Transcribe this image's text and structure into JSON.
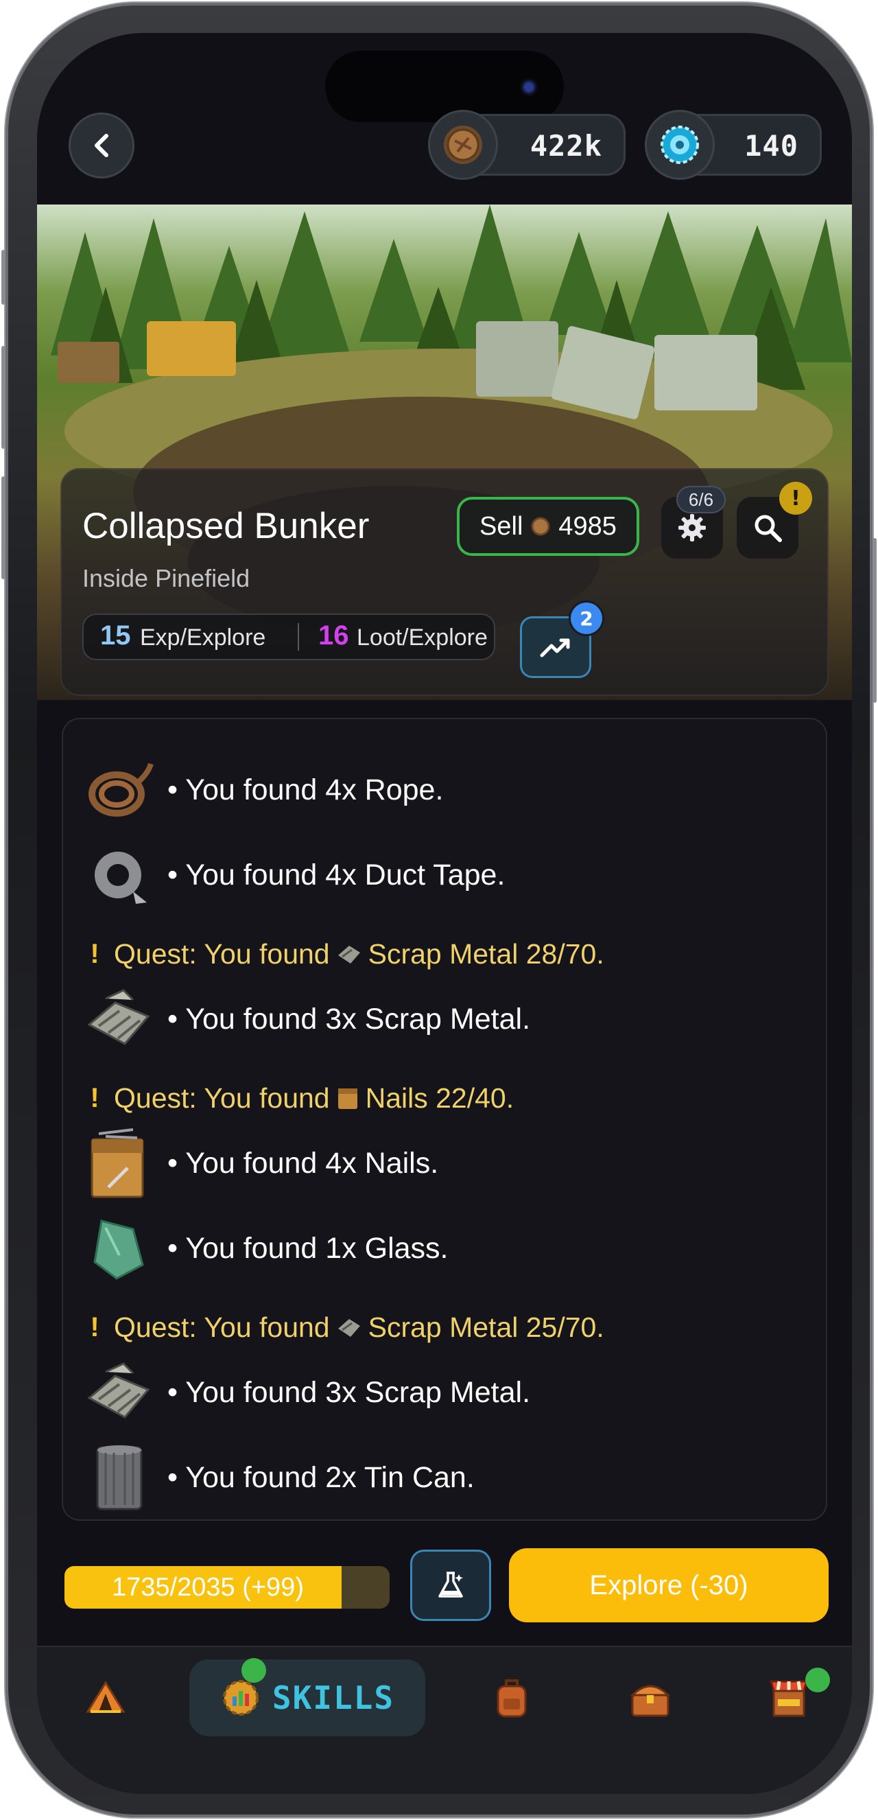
{
  "topbar": {
    "back_label": "back",
    "coins": {
      "icon": "gear-coin-icon",
      "value": "422k"
    },
    "gems": {
      "icon": "blue-gear-icon",
      "value": "140"
    }
  },
  "location": {
    "title": "Collapsed Bunker",
    "subtitle": "Inside Pinefield",
    "sell_label": "Sell",
    "sell_value": "4985",
    "settings_badge": "6/6",
    "search_alert": "!",
    "exp_value": "15",
    "exp_label": "Exp/Explore",
    "loot_value": "16",
    "loot_label": "Loot/Explore",
    "trend_badge": "2",
    "colors": {
      "exp": "#8fc9f4",
      "loot": "#d43ff0",
      "sell_border": "#39b54a"
    }
  },
  "log": [
    {
      "type": "item",
      "icon": "rope-icon",
      "text": "• You found 4x Rope."
    },
    {
      "type": "item",
      "icon": "duct-tape-icon",
      "text": "• You found 4x Duct Tape."
    },
    {
      "type": "quest",
      "icon": "scrap-metal-icon",
      "prefix": "Quest: You found",
      "text": "Scrap Metal 28/70."
    },
    {
      "type": "item",
      "icon": "scrap-metal-icon",
      "text": "• You found 3x Scrap Metal."
    },
    {
      "type": "quest",
      "icon": "nails-icon",
      "prefix": "Quest: You found",
      "text": "Nails 22/40."
    },
    {
      "type": "item",
      "icon": "nails-box-icon",
      "text": "• You found 4x Nails."
    },
    {
      "type": "item",
      "icon": "glass-icon",
      "text": "• You found 1x Glass."
    },
    {
      "type": "quest",
      "icon": "scrap-metal-icon",
      "prefix": "Quest: You found",
      "text": "Scrap Metal 25/70."
    },
    {
      "type": "item",
      "icon": "scrap-metal-icon",
      "text": "• You found 3x Scrap Metal."
    },
    {
      "type": "item",
      "icon": "tin-can-icon",
      "text": "• You found 2x Tin Can."
    }
  ],
  "actions": {
    "progress_text": "1735/2035 (+99)",
    "progress_fraction": 0.853,
    "potion_icon": "flask-icon",
    "explore_label": "Explore (-30)"
  },
  "nav": {
    "items": [
      {
        "icon": "camp-tent-icon"
      },
      {
        "icon": "skills-chart-icon",
        "label": "SKILLS"
      },
      {
        "icon": "backpack-icon"
      },
      {
        "icon": "treasure-chest-icon"
      },
      {
        "icon": "shop-stall-icon"
      }
    ]
  }
}
